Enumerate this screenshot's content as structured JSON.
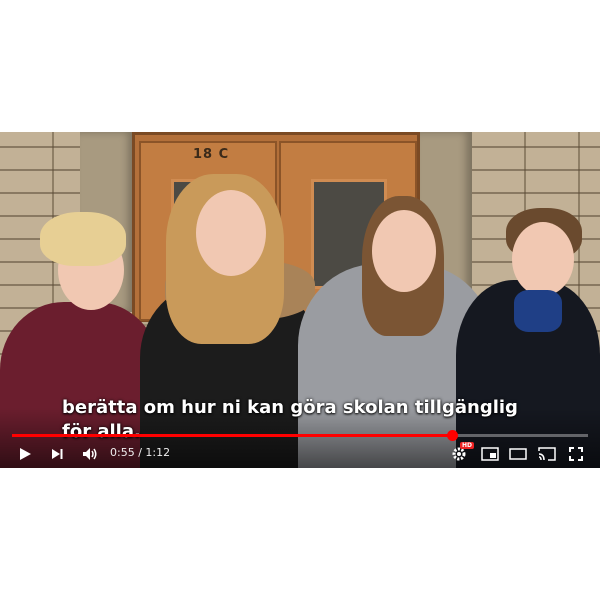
{
  "video": {
    "door_number": "18 C",
    "subtitle_lines": [
      "berätta om hur ni kan göra skolan tillgänglig",
      "för alla."
    ],
    "current_time": "0:55",
    "duration": "1:12",
    "time_display": "0:55 / 1:12",
    "progress_fraction": 0.764,
    "hd_label": "HD"
  },
  "icons": {
    "play": "play-icon",
    "next": "skip-next-icon",
    "volume": "volume-icon",
    "settings": "gear-icon",
    "miniplayer": "miniplayer-icon",
    "theater": "theater-mode-icon",
    "cast": "cast-icon",
    "fullscreen": "fullscreen-icon"
  },
  "colors": {
    "progress": "#ff0000",
    "page_background": "#ffffff"
  }
}
